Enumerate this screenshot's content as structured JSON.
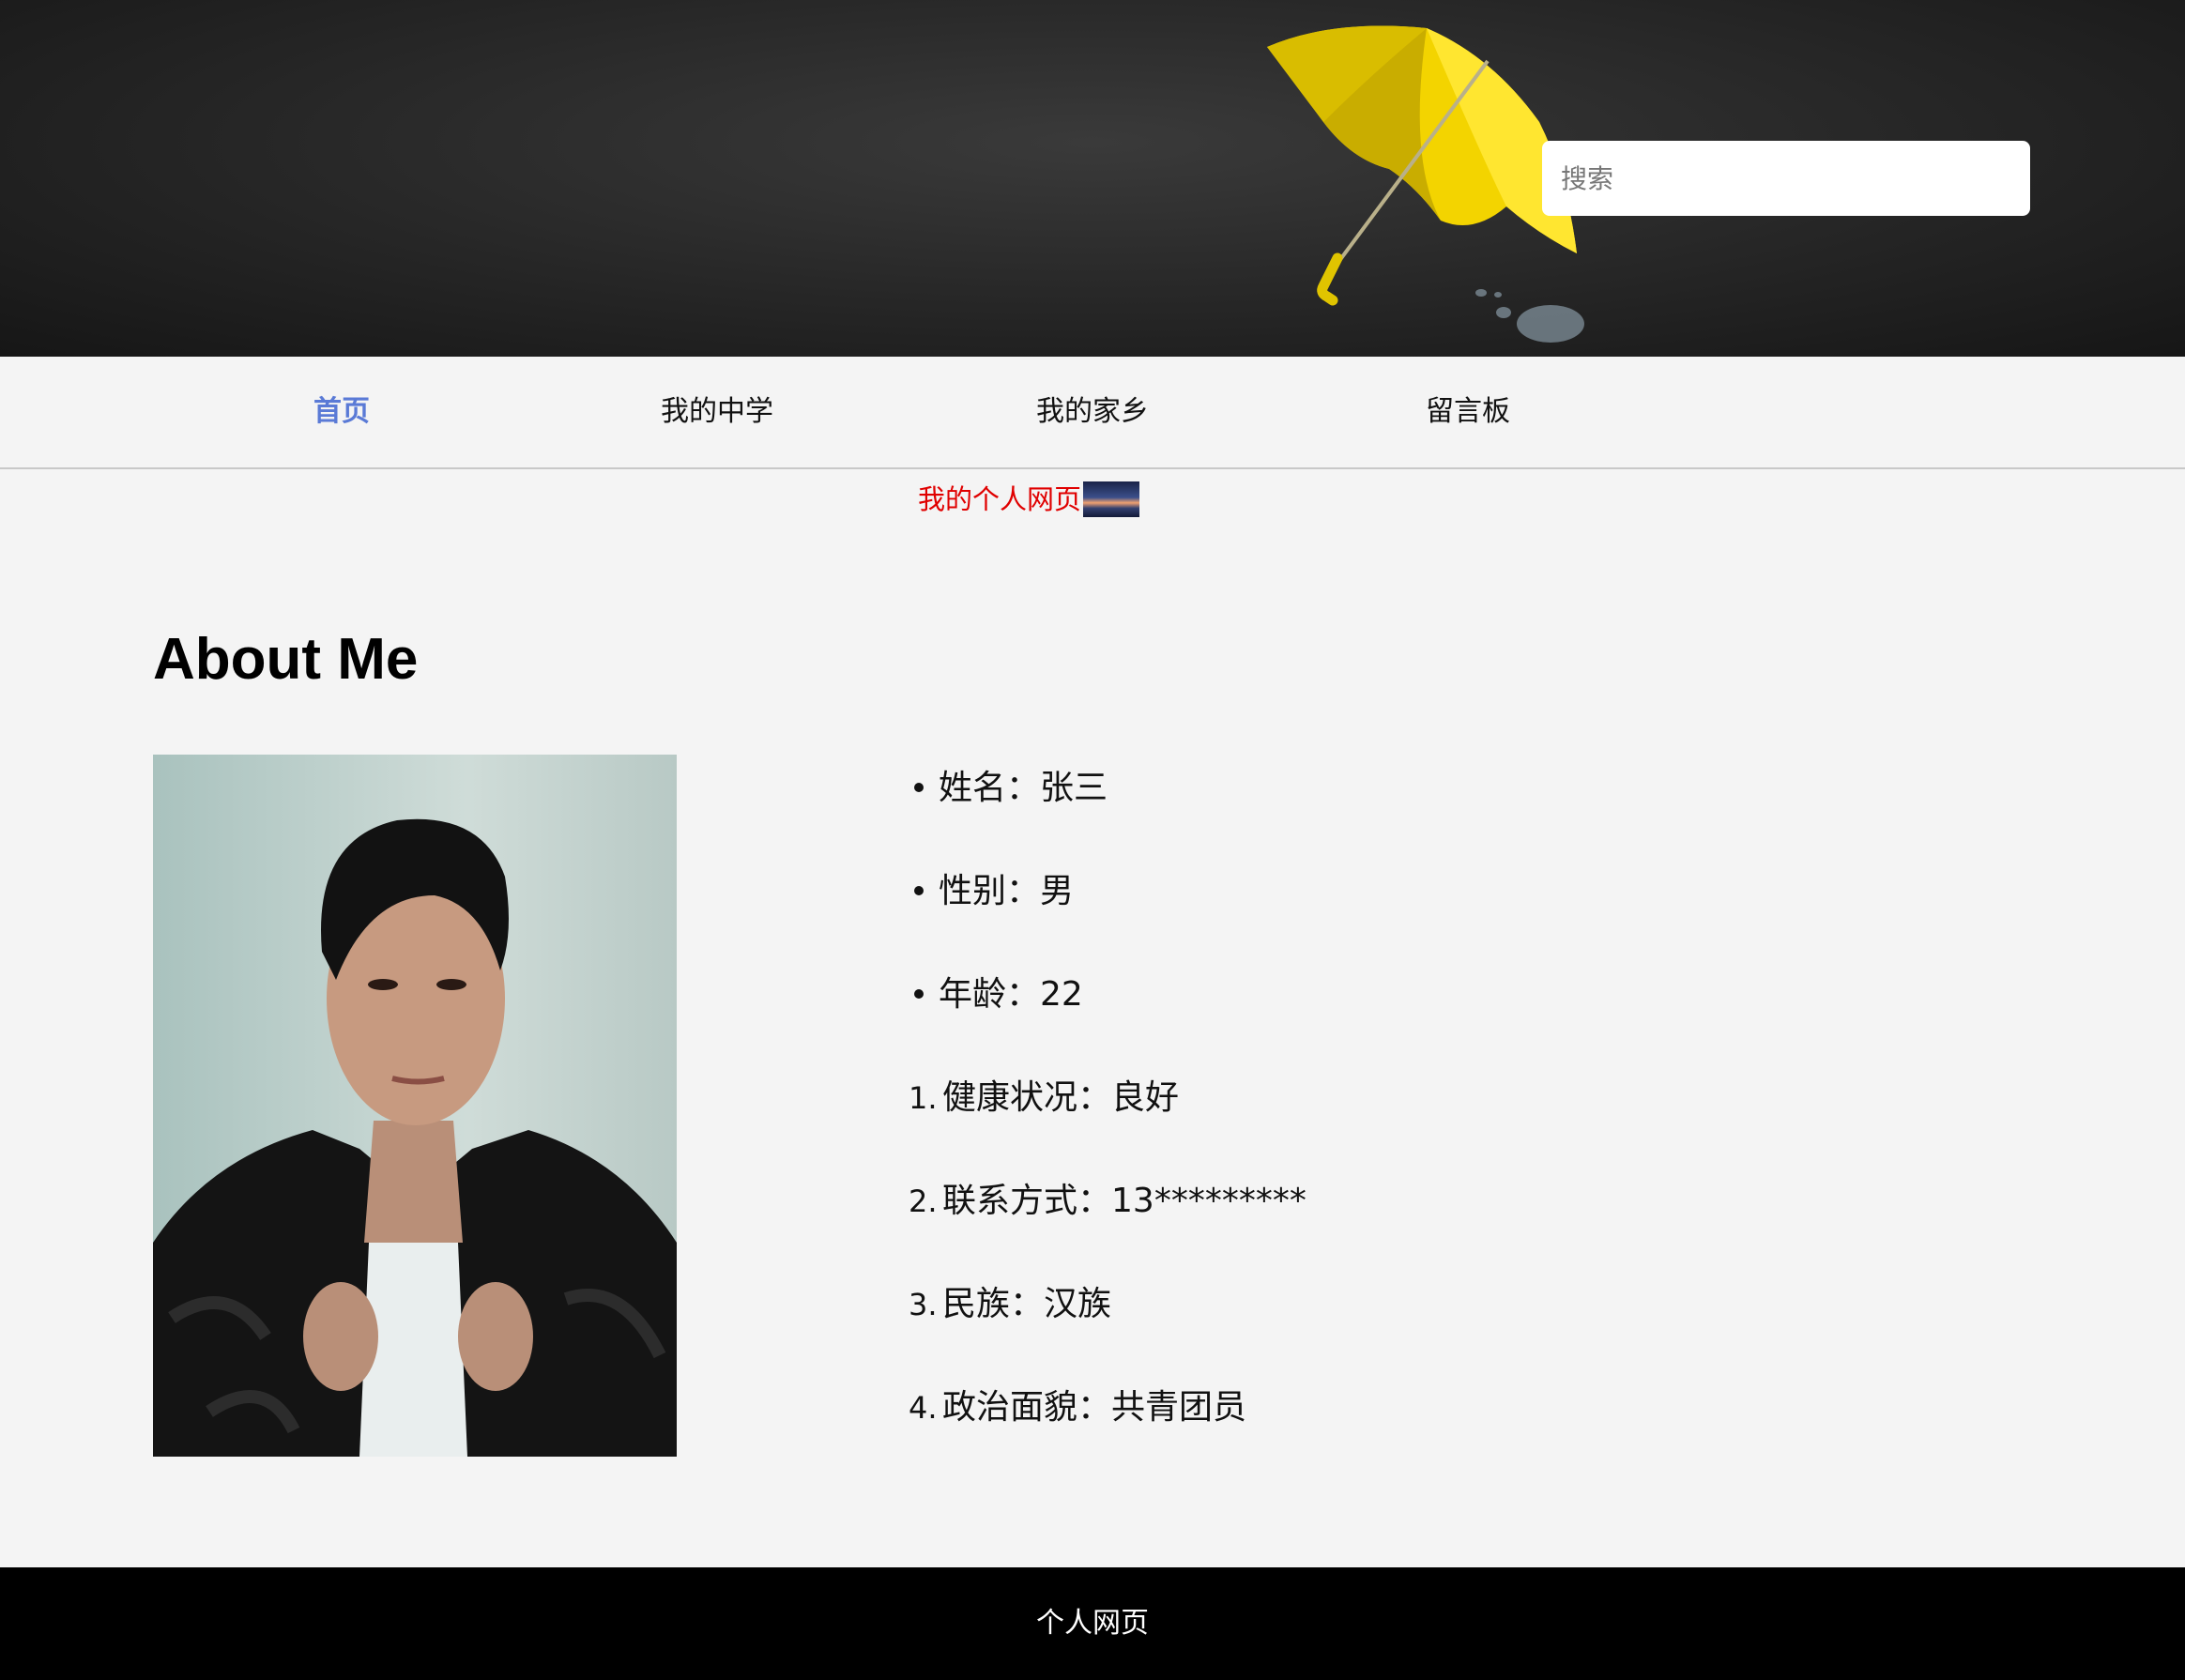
{
  "header": {
    "search_placeholder": "搜索",
    "banner_icon": "yellow-umbrella-illustration"
  },
  "nav": {
    "items": [
      {
        "label": "首页",
        "active": true
      },
      {
        "label": "我的中学",
        "active": false
      },
      {
        "label": "我的家乡",
        "active": false
      },
      {
        "label": "留言板",
        "active": false
      }
    ],
    "active_color": "#5a7ad6"
  },
  "subtitle": {
    "text": "我的个人网页",
    "color": "#e00000"
  },
  "about": {
    "title": "About Me",
    "unordered": [
      {
        "label": "姓名：",
        "value": "张三"
      },
      {
        "label": "性别：",
        "value": "男"
      },
      {
        "label": "年龄：",
        "value": "22"
      }
    ],
    "ordered": [
      {
        "num": "1.",
        "label": "健康状况：",
        "value": "良好"
      },
      {
        "num": "2.",
        "label": "联系方式：",
        "value": "13*********"
      },
      {
        "num": "3.",
        "label": "民族：",
        "value": "汉族"
      },
      {
        "num": "4.",
        "label": "政治面貌：",
        "value": "共青团员"
      }
    ]
  },
  "footer": {
    "text": "个人网页",
    "background": "#000000"
  }
}
